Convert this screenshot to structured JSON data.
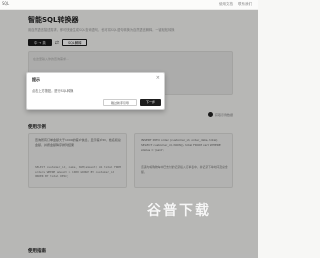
{
  "app": {
    "brand": "SQL",
    "nav": [
      "使用文档",
      "联系我们"
    ]
  },
  "hero": {
    "title": "智能SQL转换器",
    "subtitle": "用自然语言描述需求，即可快速生成SQL查询语句，也可将SQL语句转换为自然语言解释，一键轻松转换"
  },
  "modes": {
    "active": "中 → 英",
    "inactive": "SQL解释"
  },
  "input": {
    "placeholder": "在这里输入你的查询需求..."
  },
  "dialog": {
    "title": "提示",
    "body": "点击上方按钮，进行SQL转换",
    "cancel_label": "跳过新手引导",
    "next_label": "下一步"
  },
  "example_link": "获取示例数据",
  "sections": {
    "examples_title": "使用示例",
    "guide_title": "使用指南"
  },
  "examples": [
    {
      "desc": "查询所有订单金额大于1000的客户信息，显示客户ID、姓名和总金额，并按金额降序排列结果",
      "code": "SELECT customer_id, name, SUM(amount) AS total FROM orders WHERE amount > 1000 GROUP BY customer_id ORDER BY total DESC;"
    },
    {
      "desc": "INSERT INTO order (customer_id, order_date, total) SELECT customer_id, NOW(), total FROM cart WHERE status = 'paid';",
      "code": "该语句将购物车中已支付的记录插入订单表中，并记录下单时间及总金额。"
    }
  ],
  "watermark": "谷普下载"
}
